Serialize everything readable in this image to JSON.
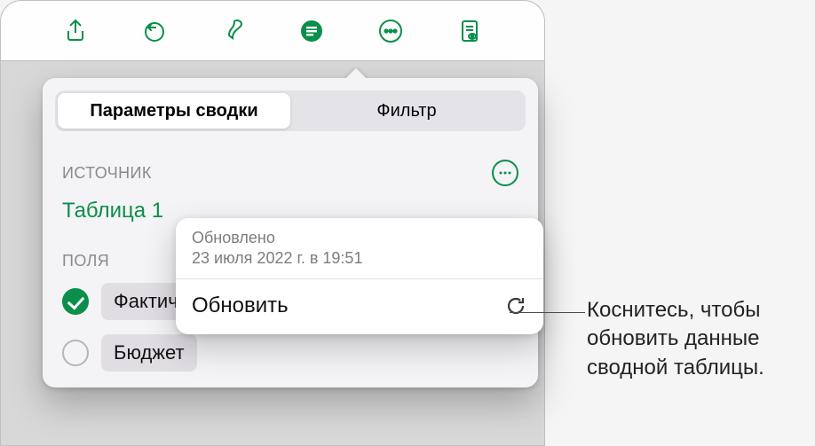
{
  "toolbar": {
    "icons": [
      "share-icon",
      "undo-icon",
      "format-brush-icon",
      "pivot-icon",
      "more-icon",
      "doc-view-icon"
    ]
  },
  "popover": {
    "tabs": {
      "summary": "Параметры сводки",
      "filter": "Фильтр",
      "active": 0
    },
    "source": {
      "label": "ИСТОЧНИК",
      "value": "Таблица 1"
    },
    "fields": {
      "label": "ПОЛЯ",
      "items": [
        {
          "name": "Фактически",
          "checked": true
        },
        {
          "name": "Бюджет",
          "checked": false
        }
      ]
    },
    "refresh": {
      "updated_label": "Обновлено",
      "updated_time": "23 июля 2022 г. в 19:51",
      "action": "Обновить"
    }
  },
  "callout": {
    "text": "Коснитесь, чтобы обновить данные сводной таблицы."
  }
}
